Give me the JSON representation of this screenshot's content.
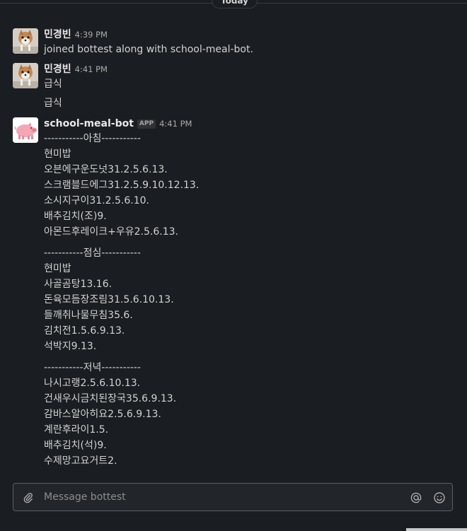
{
  "day_divider": {
    "label": "Today"
  },
  "messages": [
    {
      "author": "민경빈",
      "time": "4:39 PM",
      "lines": [
        "joined bottest along with school-meal-bot."
      ]
    },
    {
      "author": "민경빈",
      "time": "4:41 PM",
      "lines": [
        "급식",
        "급식"
      ]
    },
    {
      "author": "school-meal-bot",
      "app_badge": "APP",
      "time": "4:41 PM",
      "lines": [
        "-----------아침-----------",
        "현미밥",
        "오븐에구운도넛31.2.5.6.13.",
        "스크램블드에그31.2.5.9.10.12.13.",
        "소시지구이31.2.5.6.10.",
        "배추김치(조)9.",
        "아몬드후레이크+우유2.5.6.13.",
        "-----------점심-----------",
        "현미밥",
        "사골곰탕13.16.",
        "돈육모듬장조림31.5.6.10.13.",
        "들깨취나물무침35.6.",
        "김치전1.5.6.9.13.",
        "석박지9.13.",
        "-----------저녁-----------",
        "나시고랭2.5.6.10.13.",
        "건새우시금치된장국35.6.9.13.",
        "감바스알아히요2.5.6.9.13.",
        "계란후라이1.5.",
        "배추김치(석)9.",
        "수제망고요거트2."
      ]
    }
  ],
  "composer": {
    "placeholder": "Message bottest",
    "attach_icon": "paperclip-icon",
    "mention_icon": "at-sign-icon",
    "emoji_icon": "emoji-icon"
  }
}
